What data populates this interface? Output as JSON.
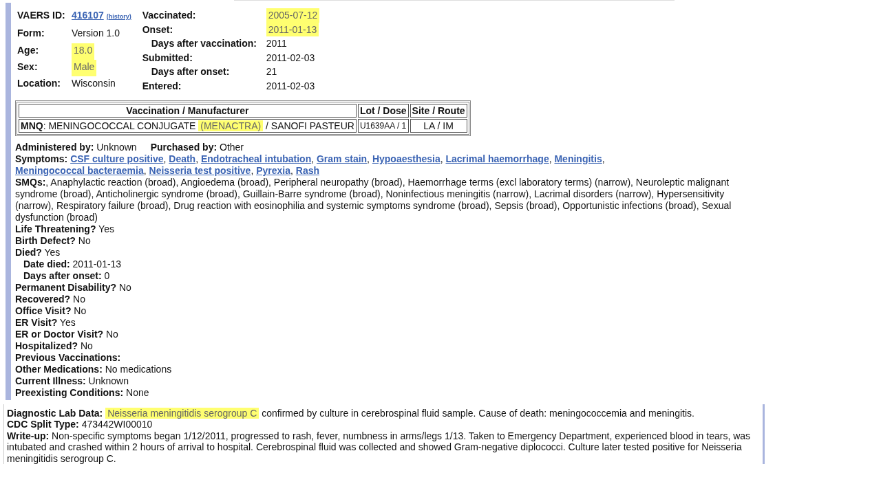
{
  "header": {
    "left": [
      {
        "label": "VAERS ID:",
        "value": "416107",
        "kind": "link",
        "extra": "(history)"
      },
      {
        "label": "Form:",
        "value": "Version 1.0",
        "kind": "text",
        "highlighted": false
      },
      {
        "label": "Age:",
        "value": "18.0",
        "kind": "text",
        "highlighted": true
      },
      {
        "label": "Sex:",
        "value": "Male",
        "kind": "text",
        "highlighted": true
      },
      {
        "label": "Location:",
        "value": "Wisconsin",
        "kind": "text",
        "highlighted": false
      }
    ],
    "right": [
      {
        "label": "Vaccinated:",
        "value": "2005-07-12",
        "kind": "main",
        "highlighted": true
      },
      {
        "label": "Onset:",
        "value": "2011-01-13",
        "kind": "main",
        "highlighted": true
      },
      {
        "label": "Days after vaccination:",
        "value": "2011",
        "kind": "sub",
        "highlighted": false
      },
      {
        "label": "Submitted:",
        "value": "2011-02-03",
        "kind": "main",
        "highlighted": false
      },
      {
        "label": "Days after onset:",
        "value": "21",
        "kind": "sub",
        "highlighted": false
      },
      {
        "label": "Entered:",
        "value": "2011-02-03",
        "kind": "main",
        "highlighted": false
      }
    ]
  },
  "vaccine_table": {
    "columns": [
      "Vaccination / Manufacturer",
      "Lot / Dose",
      "Site / Route"
    ],
    "rows": [
      {
        "code": "MNQ",
        "name": ": MENINGOCOCCAL CONJUGATE ",
        "brand": "(MENACTRA)",
        "brand_highlighted": true,
        "manufacturer": " / SANOFI PASTEUR",
        "lot_dose": "U1639AA / 1",
        "site_route": "LA / IM"
      }
    ]
  },
  "administered_by": {
    "label": "Administered by:",
    "value": "Unknown"
  },
  "purchased_by": {
    "label": "Purchased by:",
    "value": "Other"
  },
  "symptoms": {
    "label": "Symptoms:",
    "separator": ",",
    "items": [
      "CSF culture positive",
      "Death",
      "Endotracheal intubation",
      "Gram stain",
      "Hypoaesthesia",
      "Lacrimal haemorrhage",
      "Meningitis",
      "Meningococcal bacteraemia",
      "Neisseria test positive",
      "Pyrexia",
      "Rash"
    ]
  },
  "smqs": {
    "label": "SMQs:",
    "text": ", Anaphylactic reaction (broad), Angioedema (broad), Peripheral neuropathy (broad), Haemorrhage terms (excl laboratory terms) (narrow), Neuroleptic malignant syndrome (broad), Anticholinergic syndrome (broad), Guillain-Barre syndrome (broad), Noninfectious meningitis (narrow), Lacrimal disorders (narrow), Hypersensitivity (narrow), Respiratory failure (broad), Drug reaction with eosinophilia and systemic symptoms syndrome (broad), Sepsis (broad), Opportunistic infections (broad), Sexual dysfunction (broad)"
  },
  "details": [
    {
      "label": "Life Threatening?",
      "value": "Yes",
      "kind": "main"
    },
    {
      "label": "Birth Defect?",
      "value": "No",
      "kind": "main"
    },
    {
      "label": "Died?",
      "value": "Yes",
      "kind": "main"
    },
    {
      "label": "Date died:",
      "value": "2011-01-13",
      "kind": "sub"
    },
    {
      "label": "Days after onset:",
      "value": "0",
      "kind": "sub"
    },
    {
      "label": "Permanent Disability?",
      "value": "No",
      "kind": "main"
    },
    {
      "label": "Recovered?",
      "value": "No",
      "kind": "main"
    },
    {
      "label": "Office Visit?",
      "value": "No",
      "kind": "main"
    },
    {
      "label": "ER Visit?",
      "value": "Yes",
      "kind": "main"
    },
    {
      "label": "ER or Doctor Visit?",
      "value": "No",
      "kind": "main"
    },
    {
      "label": "Hospitalized?",
      "value": "No",
      "kind": "main"
    },
    {
      "label": "Previous Vaccinations:",
      "kind": "main"
    },
    {
      "label": "Other Medications:",
      "value": "No medications",
      "kind": "main"
    },
    {
      "label": "Current Illness:",
      "value": "Unknown",
      "kind": "main"
    },
    {
      "label": "Preexisting Conditions:",
      "value": "None",
      "kind": "main"
    }
  ],
  "lab": {
    "label": "Diagnostic Lab Data:",
    "highlighted_text": "Neisseria meningitidis serogroup C",
    "text": " confirmed by culture in cerebrospinal fluid sample. Cause of death: meningococcemia and meningitis.",
    "highlighted": true
  },
  "split_type": {
    "label": "CDC Split Type:",
    "value": "473442WI00010"
  },
  "writeup": {
    "label": "Write-up:",
    "text": "Non-specific symptoms began 1/12/2011, progressed to rash, fever, numbness in arms/legs 1/13. Taken to Emergency Department, experienced blood in tears, was intubated and crashed within 2 hours of arrival to hospital. Cerebrospinal fluid was collected and showed Gram-negative diplococci. Culture later tested positive for Neisseria meningitidis serogroup C."
  }
}
